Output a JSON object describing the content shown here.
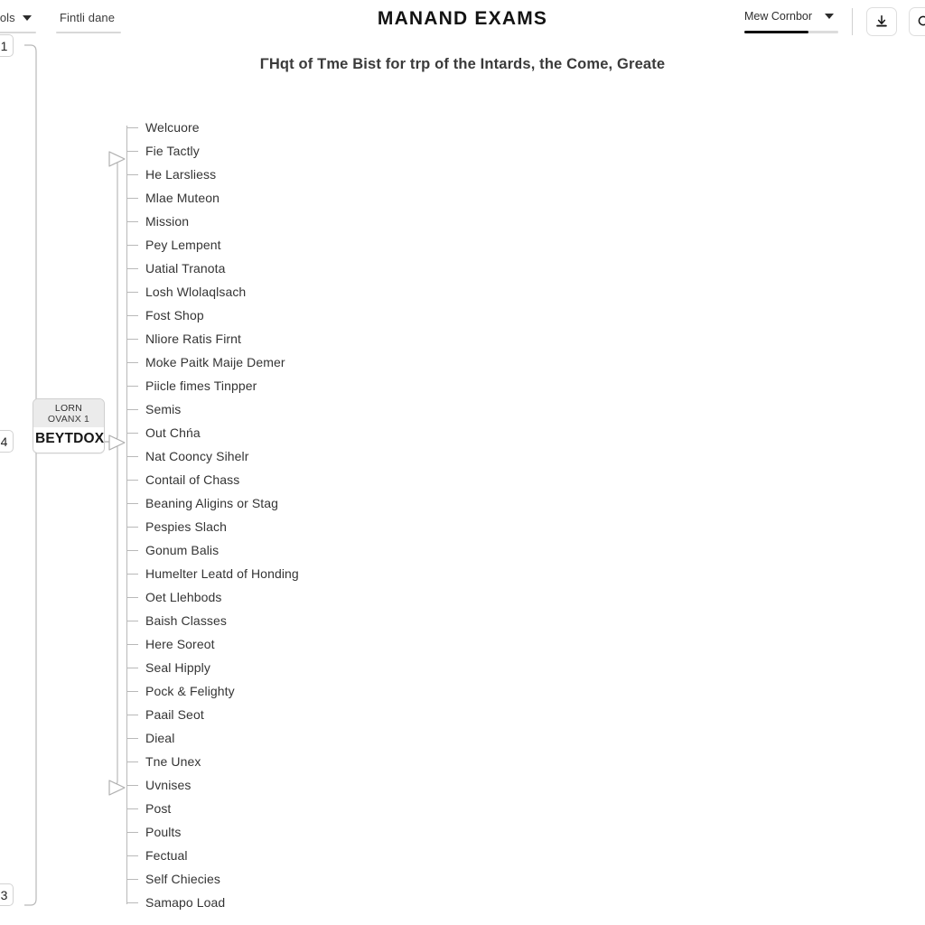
{
  "header": {
    "title": "MANAND EXAMS",
    "tabs": [
      {
        "label": "el Bfaols",
        "icon": "chevron-down-icon",
        "has_caret": true
      },
      {
        "label": "Fintli dane",
        "has_caret": false
      }
    ],
    "select": {
      "label": "Mew Cornbor",
      "icon": "chevron-down-icon"
    },
    "actions": [
      {
        "name": "download-button",
        "icon": "download-icon"
      },
      {
        "name": "search-button",
        "icon": "search-icon"
      }
    ]
  },
  "subtitle": "ΓHqt of Tme Bist for trp of the Intards, the Come, Greate",
  "rail_badges": [
    {
      "label": "1"
    },
    {
      "label": "4"
    },
    {
      "label": "3"
    }
  ],
  "node_card": {
    "head_line1": "LORN",
    "head_line2": "OVANX 1",
    "body": "BEYTDOX"
  },
  "tree": {
    "items": [
      {
        "label": "Welcuore"
      },
      {
        "label": "Fie Tactly"
      },
      {
        "label": "He Larsliess"
      },
      {
        "label": "Mlae Muteon"
      },
      {
        "label": "Mission"
      },
      {
        "label": "Pey Lempent"
      },
      {
        "label": "Uatial Tranota"
      },
      {
        "label": "Losh Wlolaqlsach"
      },
      {
        "label": "Fost Shop"
      },
      {
        "label": "Nliore Ratis Firnt"
      },
      {
        "label": "Moke Paitk Maije Demer"
      },
      {
        "label": "Piicle fimes Tinpper"
      },
      {
        "label": "Semis"
      },
      {
        "label": "Out Chńa"
      },
      {
        "label": "Nat Cooncy Sihelr"
      },
      {
        "label": "Contail of Chass"
      },
      {
        "label": "Beaning Aligins or Stag"
      },
      {
        "label": "Pespies Slach"
      },
      {
        "label": "Gonum Balis"
      },
      {
        "label": "Humelter Leatd of Honding"
      },
      {
        "label": "Oet Llehbods"
      },
      {
        "label": "Baish Classes"
      },
      {
        "label": "Here Soreot"
      },
      {
        "label": "Seal Hipply"
      },
      {
        "label": "Pock & Felighty"
      },
      {
        "label": "Paail Seot"
      },
      {
        "label": "Dieal"
      },
      {
        "label": "Tne Unex"
      },
      {
        "label": "Uvnises"
      },
      {
        "label": "Post"
      },
      {
        "label": "Poults"
      },
      {
        "label": "Fectual"
      },
      {
        "label": "Self Chiecies"
      },
      {
        "label": "Samapo Load"
      }
    ]
  },
  "colors": {
    "background": "#ffffff",
    "text": "#343434",
    "line": "#b9b9b9",
    "accent": "#111111",
    "node_head": "#ebebeb"
  }
}
